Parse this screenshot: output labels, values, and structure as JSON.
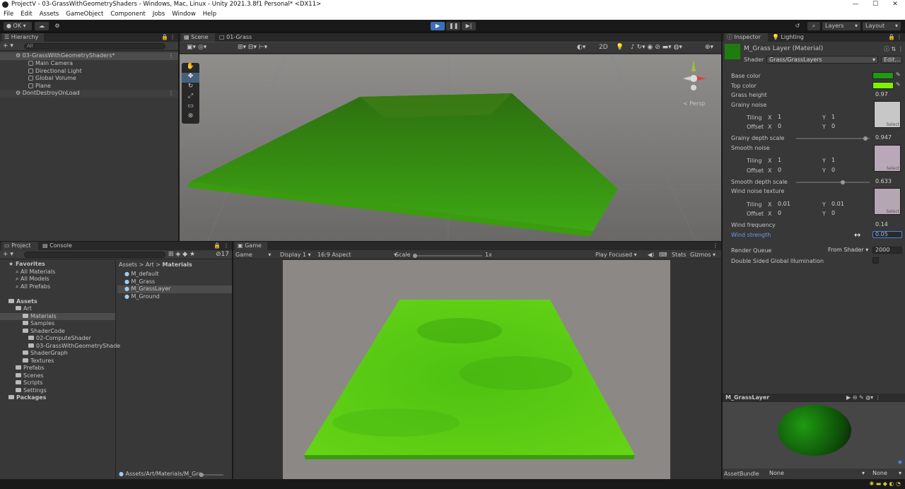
{
  "window": {
    "title": "ProjectV - 03-GrassWithGeometryShaders - Windows, Mac, Linux - Unity 2021.3.8f1 Personal* <DX11>",
    "min": "—",
    "max": "☐",
    "close": "✕"
  },
  "menu": [
    "File",
    "Edit",
    "Assets",
    "GameObject",
    "Component",
    "Jobs",
    "Window",
    "Help"
  ],
  "toolbar": {
    "account": "OK",
    "layers": "Layers",
    "layout": "Layout"
  },
  "hierarchy": {
    "tab": "Hierarchy",
    "search_placeholder": "All",
    "scene": "03-GrassWithGeometryShaders*",
    "items": [
      "Main Camera",
      "Directional Light",
      "Global Volume",
      "Plane"
    ],
    "ddol": "DontDestroyOnLoad"
  },
  "scene": {
    "tab1": "Scene",
    "tab2": "01-Grass",
    "btn2d": "2D",
    "persp": "Persp"
  },
  "project": {
    "tab1": "Project",
    "tab2": "Console",
    "count": "17",
    "tree": {
      "favorites": "Favorites",
      "fav_items": [
        "All Materials",
        "All Models",
        "All Prefabs"
      ],
      "assets": "Assets",
      "art": "Art",
      "materials": "Materials",
      "samples": "Samples",
      "shadercode": "ShaderCode",
      "sc_items": [
        "02-ComputeShader",
        "03-GrassWithGeometryShade"
      ],
      "shadergraph": "ShaderGraph",
      "textures": "Textures",
      "prefabs": "Prefabs",
      "scenes": "Scenes",
      "scripts": "Scripts",
      "settings": "Settings",
      "packages": "Packages"
    },
    "breadcrumb": [
      "Assets",
      "Art",
      "Materials"
    ],
    "files": [
      "M_default",
      "M_Grass",
      "M_GrassLayer",
      "M_Ground"
    ],
    "path": "Assets/Art/Materials/M_Gra"
  },
  "game": {
    "tab": "Game",
    "mode": "Game",
    "display": "Display 1",
    "aspect": "16:9 Aspect",
    "scale_label": "Scale",
    "scale_value": "1x",
    "play_focused": "Play Focused",
    "stats": "Stats",
    "gizmos": "Gizmos"
  },
  "inspector": {
    "tab1": "Inspector",
    "tab2": "Lighting",
    "material_name": "M_Grass Layer (Material)",
    "shader_label": "Shader",
    "shader_value": "Grass/GrassLayers",
    "edit": "Edit...",
    "props": {
      "base_color": "Base color",
      "top_color": "Top color",
      "grass_height": "Grass height",
      "grass_height_v": "0.97",
      "grainy_noise": "Grainy noise",
      "tiling": "Tiling",
      "offset": "Offset",
      "x": "X",
      "y": "Y",
      "gn_tx": "1",
      "gn_ty": "1",
      "gn_ox": "0",
      "gn_oy": "0",
      "grainy_depth": "Grainy depth scale",
      "grainy_depth_v": "0.947",
      "smooth_noise": "Smooth noise",
      "sn_tx": "1",
      "sn_ty": "1",
      "sn_ox": "0",
      "sn_oy": "0",
      "smooth_depth": "Smooth depth scale",
      "smooth_depth_v": "0.633",
      "wind_tex": "Wind noise texture",
      "wn_tx": "0.01",
      "wn_ty": "0.01",
      "wn_ox": "0",
      "wn_oy": "0",
      "wind_freq": "Wind frequency",
      "wind_freq_v": "0.14",
      "wind_str": "Wind strength",
      "wind_str_v": "0.05",
      "render_queue": "Render Queue",
      "rq_mode": "From Shader",
      "rq_value": "2000",
      "dsgi": "Double Sided Global Illumination",
      "select": "Select"
    },
    "grainy_depth_level": 0.947,
    "smooth_depth_level": 0.633,
    "preview_title": "M_GrassLayer",
    "assetbundle_label": "AssetBundle",
    "assetbundle_value": "None",
    "assetbundle_variant": "None",
    "colors": {
      "base": "#1f9a12",
      "top": "#7cf400",
      "accent": "#4c7fe0"
    }
  }
}
